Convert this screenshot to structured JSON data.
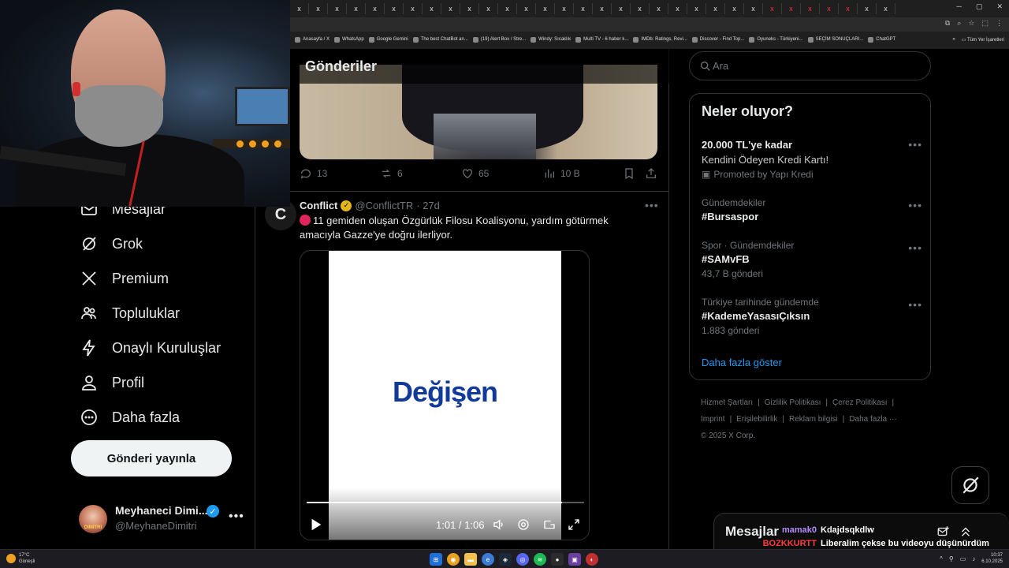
{
  "browser": {
    "tabs": [
      "x",
      "x",
      "x",
      "x",
      "x",
      "x",
      "x",
      "x",
      "x",
      "x",
      "x",
      "x",
      "x",
      "x",
      "x",
      "x",
      "x",
      "x",
      "x",
      "x",
      "x",
      "x",
      "x",
      "x",
      "x",
      "x",
      "x",
      "x",
      "x",
      "x",
      "x",
      "x"
    ],
    "bookmarks": [
      "Anasayfa / X",
      "WhatsApp",
      "Google Gemini",
      "The best ChatBot an...",
      "(19) Alert Box / Stre...",
      "Windy: Sıcaklık",
      "Multi TV - 6 haber k...",
      "IMDb: Ratings, Revi...",
      "Discover - Find Top...",
      "Oyuneks - Türkiyeni...",
      "SEÇİM SONUÇLARI...",
      "ChatGPT"
    ],
    "bookmarks_more": "»",
    "all_bookmarks": "Tüm Yer İşaretleri"
  },
  "nav": {
    "items": [
      {
        "label": "Mesajlar",
        "icon": "envelope-icon"
      },
      {
        "label": "Grok",
        "icon": "grok-icon"
      },
      {
        "label": "Premium",
        "icon": "x-logo-icon"
      },
      {
        "label": "Topluluklar",
        "icon": "people-icon"
      },
      {
        "label": "Onaylı Kuruluşlar",
        "icon": "lightning-icon"
      },
      {
        "label": "Profil",
        "icon": "person-icon"
      },
      {
        "label": "Daha fazla",
        "icon": "more-circle-icon"
      }
    ],
    "post_button": "Gönderi yayınla",
    "profile": {
      "name": "Meyhaneci Dimi...",
      "handle": "@MeyhaneDimitri",
      "more": "•••",
      "avatar_text": "DIMITRI"
    }
  },
  "timeline": {
    "header": "Gönderiler",
    "prev_post": {
      "replies": "13",
      "reposts": "6",
      "likes": "65",
      "views": "10 B"
    },
    "post": {
      "avatar_letter": "C",
      "name": "Conflict",
      "handle": "@ConflictTR",
      "time": "· 27d",
      "text": "11 gemiden oluşan Özgürlük Filosu Koalisyonu, yardım götürmek amacıyla Gazze'ye doğru ilerliyor.",
      "video": {
        "brand": "Değişen",
        "time": "1:01 / 1:06",
        "progress": 0.92
      }
    }
  },
  "right": {
    "search_placeholder": "Ara",
    "trends_title": "Neler oluyor?",
    "trends": [
      {
        "title": "20.000 TL'ye kadar",
        "sub2": "Kendini Ödeyen Kredi Kartı!",
        "promo": "Promoted by Yapı Kredi"
      },
      {
        "meta": "Gündemdekiler",
        "title": "#Bursaspor"
      },
      {
        "meta": "Spor · Gündemdekiler",
        "title": "#SAMvFB",
        "sub": "43,7 B gönderi"
      },
      {
        "meta": "Türkiye tarihinde gündemde",
        "title": "#KademeYasasıÇıksın",
        "sub": "1.883 gönderi"
      }
    ],
    "show_more": "Daha fazla göster",
    "footer": {
      "l1": [
        "Hizmet Şartları",
        "|",
        "Gizlilik Politikası",
        "|",
        "Çerez Politikası",
        "|"
      ],
      "l2": [
        "Imprint",
        "|",
        "Erişilebilirlik",
        "|",
        "Reklam bilgisi",
        "|",
        "Daha fazla ···"
      ],
      "copy": "© 2025 X Corp."
    },
    "dm_title": "Mesajlar"
  },
  "chat": [
    {
      "user": "mamak0",
      "message": "Kdajdsqkdlw"
    },
    {
      "user": "BOZKKURTT",
      "message": "Liberalim çekse bu videoyu düşünürdüm ama yine de gitmezdim"
    }
  ],
  "taskbar": {
    "weather_temp": "17°C",
    "weather_desc": "Güneşli",
    "time": "10:37",
    "date": "6.10.2025"
  },
  "colors": {
    "accent": "#1d9bf0",
    "background": "#000000",
    "border": "#2f3336",
    "muted": "#71767b"
  }
}
